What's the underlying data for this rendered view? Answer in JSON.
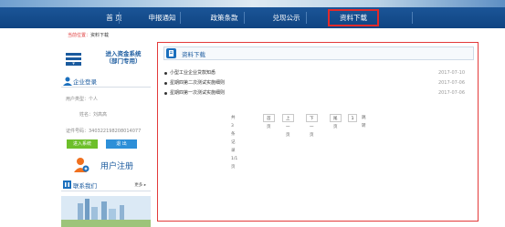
{
  "nav": {
    "items": [
      {
        "label": "首  页"
      },
      {
        "label": "申报通知"
      },
      {
        "label": "政策条款"
      },
      {
        "label": "兑现公示"
      },
      {
        "label": "资料下载"
      }
    ],
    "active_index": 4
  },
  "breadcrumb": {
    "home": "当前位置：",
    "current": "资料下载"
  },
  "sidebar": {
    "system_title_line1": "进入资金系统",
    "system_title_line2": "（部门专用）",
    "login_heading": "企业登录",
    "user_type": "用户类型：个人",
    "name": "姓名：刘高高",
    "id_number": "证件号码：340322198208014077",
    "enter_button": "进入系统",
    "logout_button": "退  出",
    "register_label": "用户注册",
    "contact_heading": "联系我们",
    "more_label": "更多 ▸"
  },
  "main": {
    "panel_title": "资料下载",
    "items": [
      {
        "title": "小型工业企业贷款知悉",
        "date": "2017-07-10"
      },
      {
        "title": "星期四第二次测试实施细则",
        "date": "2017-07-06"
      },
      {
        "title": "星期四第一次测试实施细则",
        "date": "2017-07-06"
      }
    ],
    "pager": {
      "summary": "共3条记录1/1页",
      "first": "首页",
      "prev": "上一页",
      "next": "下一页",
      "last": "尾页",
      "page_value": "1",
      "jump": "跳转"
    }
  },
  "colors": {
    "nav_bg": "#1b5597",
    "highlight": "#e33a3a",
    "accent": "#1a5a9e"
  }
}
